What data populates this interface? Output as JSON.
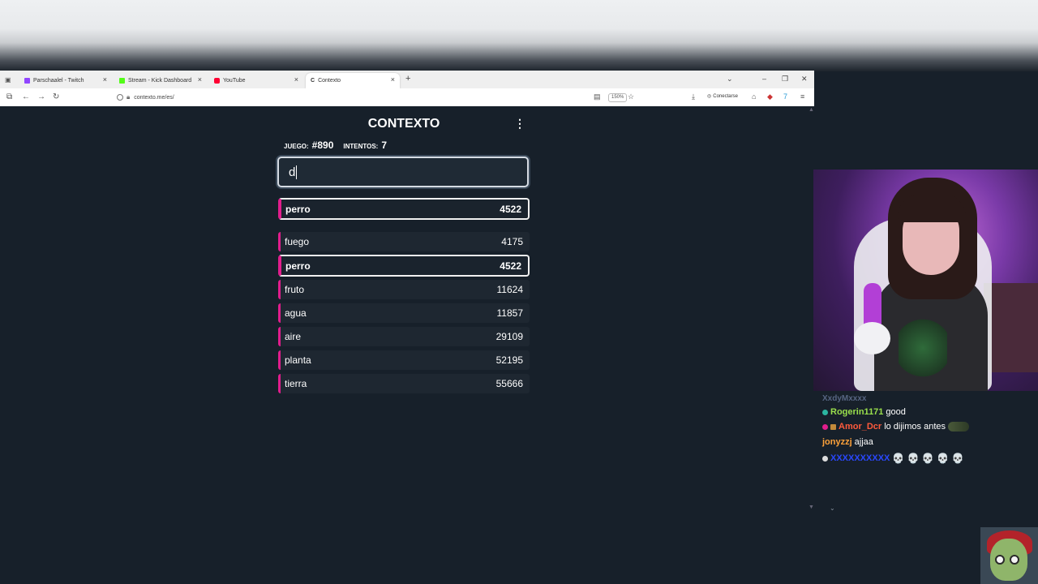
{
  "browser": {
    "tabs": [
      {
        "label": "Parschaalel - Twitch",
        "color": "#9146ff"
      },
      {
        "label": "Stream - Kick Dashboard",
        "color": "#53fc18"
      },
      {
        "label": "YouTube",
        "color": "#ff0033"
      },
      {
        "label": "Contexto",
        "color": "#333333"
      }
    ],
    "url": "contexto.me/es/",
    "zoom": "150%",
    "connect_label": "Conectarse"
  },
  "game": {
    "title": "CONTEXTO",
    "game_label": "JUEGO:",
    "game_number": "#890",
    "attempts_label": "INTENTOS:",
    "attempts": "7",
    "input_value": "d",
    "last_guess": {
      "word": "perro",
      "rank": "4522"
    },
    "guesses": [
      {
        "word": "fuego",
        "rank": "4175",
        "highlight": false
      },
      {
        "word": "perro",
        "rank": "4522",
        "highlight": true
      },
      {
        "word": "fruto",
        "rank": "11624",
        "highlight": false
      },
      {
        "word": "agua",
        "rank": "11857",
        "highlight": false
      },
      {
        "word": "aire",
        "rank": "29109",
        "highlight": false
      },
      {
        "word": "planta",
        "rank": "52195",
        "highlight": false
      },
      {
        "word": "tierra",
        "rank": "55666",
        "highlight": false
      }
    ],
    "accent_color": "#e11d8c"
  },
  "chat": {
    "messages": [
      {
        "user": "XxdyMxxxx",
        "text": "",
        "color": "#8a9cc8"
      },
      {
        "user": "Rogerin1171",
        "text": "good",
        "color": "#9adf4c"
      },
      {
        "user": "Amor_Dcr",
        "text": "lo dijimos antes",
        "color": "#ff5a3c"
      },
      {
        "user": "jonyzzj",
        "text": "ajjaa",
        "color": "#ffa23a"
      },
      {
        "user": "XXXXXXXXXX",
        "text": "💀 💀 💀 💀 💀",
        "color": "#2a48ff"
      }
    ]
  }
}
